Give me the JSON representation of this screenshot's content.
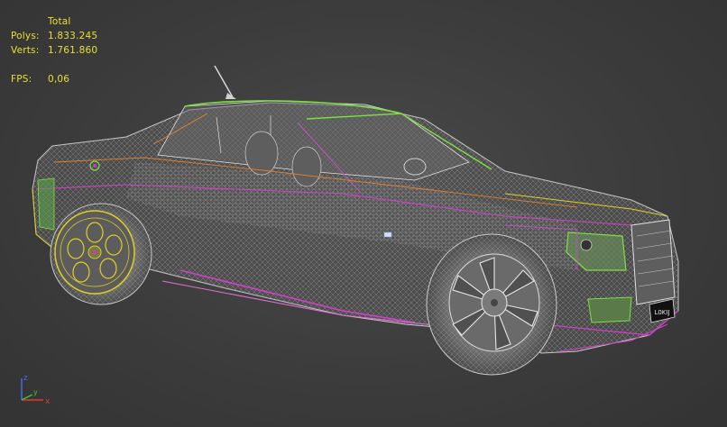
{
  "stats": {
    "header": "Total",
    "polys_label": "Polys:",
    "polys_value": "1.833.245",
    "verts_label": "Verts:",
    "verts_value": "1.761.860",
    "fps_label": "FPS:",
    "fps_value": "0,06"
  },
  "gizmo": {
    "z_label": "z",
    "x_label": "x",
    "y_label": "y",
    "z_color": "#3f6fe0",
    "x_color": "#e03a2a",
    "y_color": "#3fc03a"
  },
  "license_plate": {
    "text": "L0KIJ"
  },
  "colors": {
    "background": "#3c3c3c",
    "stats_text": "#e8e030",
    "wire_grey": "#b8b8b8",
    "wire_magenta": "#d040c8",
    "wire_green": "#7ee040",
    "wire_yellow": "#e0d020",
    "wire_orange": "#e08030"
  }
}
